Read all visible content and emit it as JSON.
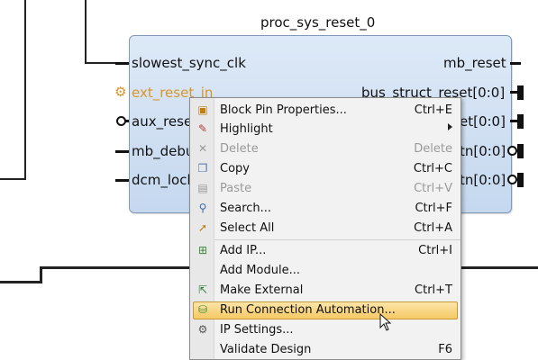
{
  "block": {
    "title": "proc_sys_reset_0",
    "left_pins": [
      "slowest_sync_clk",
      "ext_reset_in",
      "aux_rese",
      "mb_debu",
      "dcm_lock"
    ],
    "right_pins": [
      "mb_reset",
      "bus_struct_reset[0:0]",
      "et[0:0]",
      "tn[0:0]",
      "tn[0:0]"
    ]
  },
  "context_menu": {
    "items": [
      {
        "icon": "block-pin-properties-icon",
        "label": "Block Pin Properties...",
        "shortcut": "Ctrl+E",
        "enabled": true
      },
      {
        "icon": "highlight-icon",
        "label": "Highlight",
        "shortcut": "",
        "enabled": true,
        "submenu": true
      },
      {
        "icon": "delete-icon",
        "label": "Delete",
        "shortcut": "Delete",
        "enabled": false
      },
      {
        "icon": "copy-icon",
        "label": "Copy",
        "shortcut": "Ctrl+C",
        "enabled": true
      },
      {
        "icon": "paste-icon",
        "label": "Paste",
        "shortcut": "Ctrl+V",
        "enabled": false
      },
      {
        "icon": "search-icon",
        "label": "Search...",
        "shortcut": "Ctrl+F",
        "enabled": true
      },
      {
        "icon": "select-all-icon",
        "label": "Select All",
        "shortcut": "Ctrl+A",
        "enabled": true
      },
      {
        "icon": "add-ip-icon",
        "label": "Add IP...",
        "shortcut": "Ctrl+I",
        "enabled": true
      },
      {
        "icon": "",
        "label": "Add Module...",
        "shortcut": "",
        "enabled": true
      },
      {
        "icon": "make-external-icon",
        "label": "Make External",
        "shortcut": "Ctrl+T",
        "enabled": true
      },
      {
        "icon": "run-connection-automation-icon",
        "label": "Run Connection Automation...",
        "shortcut": "",
        "enabled": true,
        "highlighted": true
      },
      {
        "icon": "ip-settings-icon",
        "label": "IP Settings...",
        "shortcut": "",
        "enabled": true
      },
      {
        "icon": "",
        "label": "Validate Design",
        "shortcut": "F6",
        "enabled": true
      }
    ]
  }
}
